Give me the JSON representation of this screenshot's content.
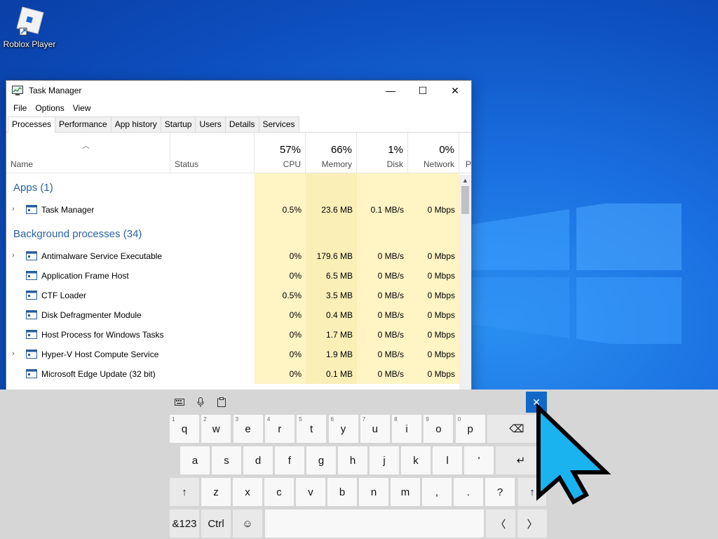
{
  "desktop": {
    "icon_label": "Roblox Player"
  },
  "window": {
    "title": "Task Manager",
    "controls": {
      "minimize": "—",
      "maximize": "☐",
      "close": "✕"
    },
    "menu": [
      "File",
      "Options",
      "View"
    ],
    "tabs": [
      "Processes",
      "Performance",
      "App history",
      "Startup",
      "Users",
      "Details",
      "Services"
    ],
    "active_tab": "Processes"
  },
  "columns": {
    "name": "Name",
    "status": "Status",
    "cpu": {
      "pct": "57%",
      "label": "CPU"
    },
    "memory": {
      "pct": "66%",
      "label": "Memory"
    },
    "disk": {
      "pct": "1%",
      "label": "Disk"
    },
    "network": {
      "pct": "0%",
      "label": "Network"
    },
    "extra": "P"
  },
  "groups": {
    "apps": "Apps (1)",
    "background": "Background processes (34)"
  },
  "apps_rows": [
    {
      "name": "Task Manager",
      "cpu": "0.5%",
      "memory": "23.6 MB",
      "disk": "0.1 MB/s",
      "network": "0 Mbps",
      "expandable": true
    }
  ],
  "background_rows": [
    {
      "name": "Antimalware Service Executable",
      "cpu": "0%",
      "memory": "179.6 MB",
      "disk": "0 MB/s",
      "network": "0 Mbps",
      "expandable": true
    },
    {
      "name": "Application Frame Host",
      "cpu": "0%",
      "memory": "6.5 MB",
      "disk": "0 MB/s",
      "network": "0 Mbps",
      "expandable": false
    },
    {
      "name": "CTF Loader",
      "cpu": "0.5%",
      "memory": "3.5 MB",
      "disk": "0 MB/s",
      "network": "0 Mbps",
      "expandable": false
    },
    {
      "name": "Disk Defragmenter Module",
      "cpu": "0%",
      "memory": "0.4 MB",
      "disk": "0 MB/s",
      "network": "0 Mbps",
      "expandable": false
    },
    {
      "name": "Host Process for Windows Tasks",
      "cpu": "0%",
      "memory": "1.7 MB",
      "disk": "0 MB/s",
      "network": "0 Mbps",
      "expandable": false
    },
    {
      "name": "Hyper-V Host Compute Service",
      "cpu": "0%",
      "memory": "1.9 MB",
      "disk": "0 MB/s",
      "network": "0 Mbps",
      "expandable": true
    },
    {
      "name": "Microsoft Edge Update (32 bit)",
      "cpu": "0%",
      "memory": "0.1 MB",
      "disk": "0 MB/s",
      "network": "0 Mbps",
      "expandable": false
    }
  ],
  "keyboard": {
    "row1": [
      {
        "k": "q",
        "n": "1"
      },
      {
        "k": "w",
        "n": "2"
      },
      {
        "k": "e",
        "n": "3"
      },
      {
        "k": "r",
        "n": "4"
      },
      {
        "k": "t",
        "n": "5"
      },
      {
        "k": "y",
        "n": "6"
      },
      {
        "k": "u",
        "n": "7"
      },
      {
        "k": "i",
        "n": "8"
      },
      {
        "k": "o",
        "n": "9"
      },
      {
        "k": "p",
        "n": "0"
      }
    ],
    "row2": [
      "a",
      "s",
      "d",
      "f",
      "g",
      "h",
      "j",
      "k",
      "l",
      "'"
    ],
    "row3": [
      "z",
      "x",
      "c",
      "v",
      "b",
      "n",
      "m",
      ",",
      ".",
      "?"
    ],
    "backspace": "⌫",
    "enter": "↵",
    "shift": "↑",
    "symbols": "&123",
    "ctrl": "Ctrl",
    "emoji": "☺",
    "left": "〈",
    "right": "〉",
    "close": "✕"
  },
  "colors": {
    "accent": "#1168c9",
    "group_title": "#2a62a6",
    "heat_light": "#fff4c4",
    "heat_medium": "#f9eca8",
    "cursor": "#1ab3f0"
  }
}
